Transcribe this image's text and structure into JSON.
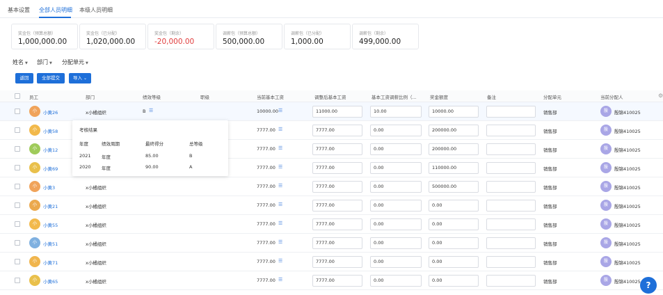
{
  "tabs": [
    "基本设置",
    "全部人员明细",
    "本级人员明细"
  ],
  "stats": [
    {
      "label": "奖金包（预算总额）",
      "value": "1,000,000.00"
    },
    {
      "label": "奖金包（已分配）",
      "value": "1,020,000.00"
    },
    {
      "label": "奖金包（剩余）",
      "value": "-20,000.00"
    },
    {
      "label": "调薪包（预算总额）",
      "value": "500,000.00"
    },
    {
      "label": "调薪包（已分配）",
      "value": "1,000.00"
    },
    {
      "label": "调薪包（剩余）",
      "value": "499,000.00"
    }
  ],
  "filters": [
    "姓名",
    "部门",
    "分配单元"
  ],
  "buttons": {
    "back": "返回",
    "submit_all": "全部提交",
    "import": "导入"
  },
  "columns": [
    "员工",
    "部门",
    "绩效等级",
    "职级",
    "当前基本工资",
    "调整后基本工资",
    "基本工资调薪比例（...",
    "奖金额度",
    "备注",
    "分配单元",
    "当前分配人"
  ],
  "rows": [
    {
      "avatar": "小",
      "name": "小黄26",
      "dept": "x小橘组织",
      "grade": "B",
      "salary": "10000.00",
      "adj": "11000.00",
      "ratio": "10.00",
      "bonus": "10000.00",
      "unit": "销售部",
      "alloc_avatar": "殷",
      "allocator": "殷锦410025"
    },
    {
      "avatar": "小",
      "name": "小黄58",
      "dept": "",
      "grade": "",
      "salary": "7777.00",
      "adj": "7777.00",
      "ratio": "0.00",
      "bonus": "200000.00",
      "unit": "销售部",
      "alloc_avatar": "殷",
      "allocator": "殷锦410025"
    },
    {
      "avatar": "小",
      "name": "小黄12",
      "dept": "",
      "grade": "",
      "salary": "7777.00",
      "adj": "7777.00",
      "ratio": "0.00",
      "bonus": "200000.00",
      "unit": "销售部",
      "alloc_avatar": "殷",
      "allocator": "殷锦410025"
    },
    {
      "avatar": "小",
      "name": "小黄69",
      "dept": "",
      "grade": "",
      "salary": "7777.00",
      "adj": "7777.00",
      "ratio": "0.00",
      "bonus": "110000.00",
      "unit": "销售部",
      "alloc_avatar": "殷",
      "allocator": "殷锦410025"
    },
    {
      "avatar": "小",
      "name": "小黄3",
      "dept": "x小橘组织",
      "grade": "",
      "salary": "7777.00",
      "adj": "7777.00",
      "ratio": "0.00",
      "bonus": "500000.00",
      "unit": "销售部",
      "alloc_avatar": "殷",
      "allocator": "殷锦410025"
    },
    {
      "avatar": "小",
      "name": "小黄21",
      "dept": "x小橘组织",
      "grade": "",
      "salary": "7777.00",
      "adj": "7777.00",
      "ratio": "0.00",
      "bonus": "0.00",
      "unit": "销售部",
      "alloc_avatar": "殷",
      "allocator": "殷锦410025"
    },
    {
      "avatar": "小",
      "name": "小黄55",
      "dept": "x小橘组织",
      "grade": "",
      "salary": "7777.00",
      "adj": "7777.00",
      "ratio": "0.00",
      "bonus": "0.00",
      "unit": "销售部",
      "alloc_avatar": "殷",
      "allocator": "殷锦410025"
    },
    {
      "avatar": "小",
      "name": "小黄51",
      "dept": "x小橘组织",
      "grade": "",
      "salary": "7777.00",
      "adj": "7777.00",
      "ratio": "0.00",
      "bonus": "0.00",
      "unit": "销售部",
      "alloc_avatar": "殷",
      "allocator": "殷锦410025"
    },
    {
      "avatar": "小",
      "name": "小黄71",
      "dept": "x小橘组织",
      "grade": "",
      "salary": "7777.00",
      "adj": "7777.00",
      "ratio": "0.00",
      "bonus": "0.00",
      "unit": "销售部",
      "alloc_avatar": "殷",
      "allocator": "殷锦410025"
    },
    {
      "avatar": "小",
      "name": "小黄65",
      "dept": "x小橘组织",
      "grade": "",
      "salary": "7777.00",
      "adj": "7777.00",
      "ratio": "0.00",
      "bonus": "0.00",
      "unit": "销售部",
      "alloc_avatar": "殷",
      "allocator": "殷锦410025"
    }
  ],
  "popover": {
    "title": "考核结果",
    "headers": [
      "年度",
      "绩效周期",
      "最终得分",
      "总等级"
    ],
    "records": [
      [
        "2021",
        "年度",
        "85.00",
        "B"
      ],
      [
        "2020",
        "年度",
        "90.00",
        "A"
      ]
    ]
  },
  "colors": {
    "primary": "#1e6fd9",
    "negative": "#e03d3d"
  },
  "icons": {
    "list": "list-icon",
    "help": "question-icon",
    "settings": "gear-icon"
  }
}
